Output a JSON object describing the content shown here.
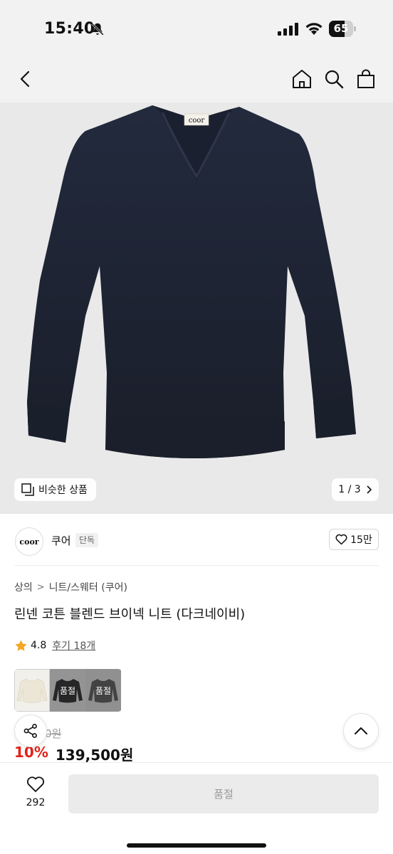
{
  "status_bar": {
    "time": "15:40",
    "battery": "65",
    "battery_level": 0.65,
    "icons": [
      "bell-slash-icon",
      "signal-icon",
      "wifi-icon",
      "battery-icon"
    ]
  },
  "nav": {
    "icons": [
      "back-arrow-icon",
      "home-icon",
      "search-icon",
      "shopping-bag-icon"
    ]
  },
  "gallery": {
    "similar_label": "비슷한 상품",
    "pager": "1 / 3",
    "image_brand_tag": "coor"
  },
  "brand": {
    "logo_text": "coor",
    "name": "쿠어",
    "badge": "단독",
    "likes": "15만"
  },
  "breadcrumb": [
    "상의",
    "니트/스웨터 (쿠어)"
  ],
  "product": {
    "title": "린넨 코튼 블렌드 브이넥 니트 (다크네이비)",
    "rating": "4.8",
    "review_label": "후기 18개",
    "original_price_fragment": "0원",
    "discount": "10%",
    "sale_price": "139,500원"
  },
  "color_options": [
    {
      "color": "#ece6d6",
      "sold_label": ""
    },
    {
      "color": "#151515",
      "sold_label": "품절"
    },
    {
      "color": "#4a4a4a",
      "sold_label": "품절"
    }
  ],
  "bottom_bar": {
    "wish_count": "292",
    "cta_label": "품절"
  },
  "colors": {
    "discount": "#e2231a",
    "star": "#f5a623",
    "image_background": "#e9e9e9",
    "sweater": "#1f2434"
  }
}
